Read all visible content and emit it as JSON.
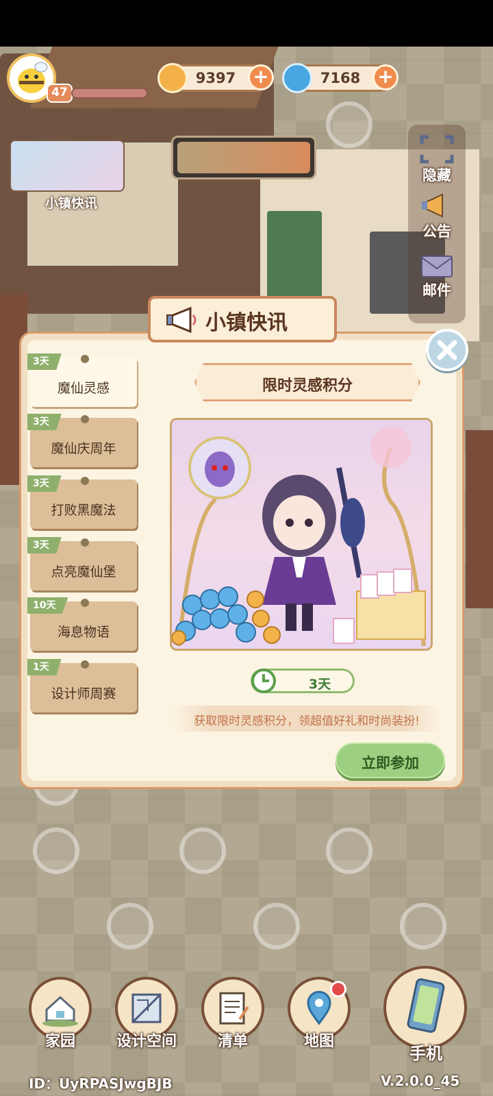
{
  "hud": {
    "level": "47",
    "coins": "9397",
    "gems": "7168"
  },
  "news_card": {
    "label": "小镇快讯"
  },
  "side_menu": {
    "hide": "隐藏",
    "notice": "公告",
    "mail": "邮件"
  },
  "dialog": {
    "title": "小镇快讯",
    "tabs": [
      {
        "days": "3天",
        "label": "魔仙灵感"
      },
      {
        "days": "3天",
        "label": "魔仙庆周年"
      },
      {
        "days": "3天",
        "label": "打败黑魔法"
      },
      {
        "days": "3天",
        "label": "点亮魔仙堡"
      },
      {
        "days": "10天",
        "label": "海息物语"
      },
      {
        "days": "1天",
        "label": "设计师周赛"
      }
    ],
    "event_title": "限时灵感积分",
    "timer": "3天",
    "description": "获取限时灵感积分，领超值好礼和时尚装扮!",
    "join_button": "立即参加"
  },
  "bottom_nav": {
    "home": "家园",
    "design": "设计空间",
    "list": "清单",
    "map": "地图",
    "phone": "手机"
  },
  "footer": {
    "id": "ID：UyRPASJwgBJB",
    "version": "V.2.0.0_45"
  },
  "colors": {
    "accent_orange": "#f08c4e",
    "accent_green": "#9ccf7f",
    "panel_bg": "#fcf4e3",
    "frame_brown": "#c9875c"
  }
}
